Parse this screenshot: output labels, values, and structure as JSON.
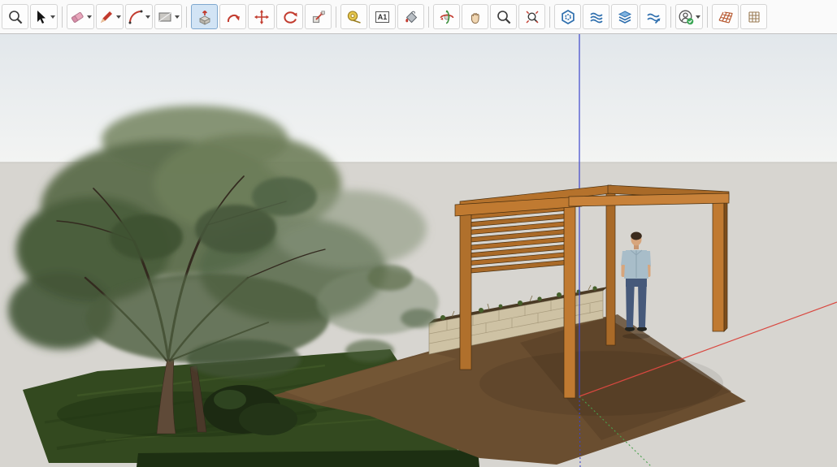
{
  "toolbar": {
    "active_tool": "push-pull",
    "dimension_icon_label": "A1",
    "tools": [
      {
        "name": "zoom-window",
        "icon": "magnifier-icon"
      },
      {
        "name": "select",
        "icon": "cursor-arrow-icon",
        "dropdown": true
      },
      {
        "name": "eraser",
        "icon": "eraser-icon",
        "dropdown": true
      },
      {
        "name": "lines",
        "icon": "pencil-icon",
        "dropdown": true
      },
      {
        "name": "arcs",
        "icon": "arc-icon",
        "dropdown": true
      },
      {
        "name": "shapes",
        "icon": "rectangle-icon",
        "dropdown": true
      },
      {
        "name": "push-pull",
        "icon": "push-pull-icon",
        "active": true
      },
      {
        "name": "follow-me",
        "icon": "follow-me-icon"
      },
      {
        "name": "move",
        "icon": "move-arrows-icon"
      },
      {
        "name": "rotate",
        "icon": "rotate-icon"
      },
      {
        "name": "scale",
        "icon": "scale-icon"
      },
      {
        "name": "tape-measure",
        "icon": "tape-measure-icon"
      },
      {
        "name": "dimensions",
        "icon": "dimension-a1-icon"
      },
      {
        "name": "paint-bucket",
        "icon": "paint-bucket-icon"
      },
      {
        "name": "orbit",
        "icon": "orbit-icon"
      },
      {
        "name": "pan",
        "icon": "hand-icon"
      },
      {
        "name": "zoom",
        "icon": "magnifier-icon"
      },
      {
        "name": "zoom-extents",
        "icon": "magnifier-extents-icon"
      },
      {
        "name": "extension-warehouse",
        "icon": "hexagon-gear-icon"
      },
      {
        "name": "sandbox-from-contours",
        "icon": "wavy-lines-icon"
      },
      {
        "name": "add-location",
        "icon": "layer-stack-icon"
      },
      {
        "name": "sandbox-smoove",
        "icon": "wavy-arrow-icon"
      },
      {
        "name": "account",
        "icon": "person-check-icon",
        "dropdown": true,
        "status": "signed-in"
      },
      {
        "name": "sandbox-grid-a",
        "icon": "tilted-grid-icon"
      },
      {
        "name": "sandbox-grid-b",
        "icon": "flat-grid-icon"
      }
    ]
  },
  "viewport": {
    "scene_objects": [
      "tree",
      "lawn",
      "dirt path",
      "stone planter wall",
      "wooden pergola with louvered screen",
      "person figure"
    ],
    "axes": {
      "blue": "#3c45cc",
      "red": "#d84840",
      "green": "#4aa24e"
    },
    "colors": {
      "sky_top": "#e2e7eb",
      "sky_horizon": "#f3f4f3",
      "ground": "#d7d5d0",
      "lawn": "#33491f",
      "dirt": "#6a4e30",
      "wood": "#c07a31",
      "stone": "#cec2a4",
      "shirt": "#a8bdc9",
      "jeans": "#46597a"
    }
  }
}
